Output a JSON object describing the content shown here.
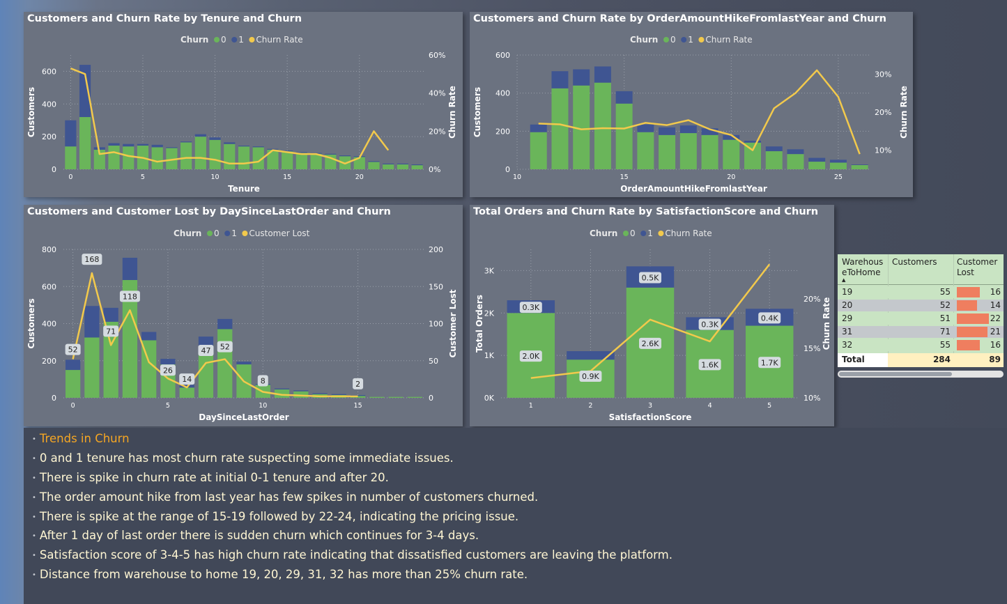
{
  "colors": {
    "churn0": "#6ab55a",
    "churn1": "#3f5592",
    "line": "#f2c94c",
    "grid": "#9aa0aa",
    "text": "#ffffff",
    "table_bar": "#ef7e5f",
    "table_bg": "#c9e4c3",
    "total_bg": "#fff0c0",
    "notes_title": "#f5a623"
  },
  "chart_data": [
    {
      "type": "bar",
      "stacked": true,
      "title": "Customers and Churn Rate by Tenure and Churn",
      "legend": {
        "title": "Churn",
        "items": [
          "0",
          "1",
          "Churn Rate"
        ]
      },
      "xlabel": "Tenure",
      "ylabel": "Customers",
      "y2label": "Churn Rate",
      "xticks": [
        "0",
        "5",
        "10",
        "15",
        "20"
      ],
      "yticks": [
        "0",
        "200",
        "400",
        "600"
      ],
      "y2ticks": [
        "0%",
        "20%",
        "40%",
        "60%"
      ],
      "ylim": [
        0,
        700
      ],
      "y2lim": [
        0,
        0.6
      ],
      "x": [
        0,
        1,
        2,
        3,
        4,
        5,
        6,
        7,
        8,
        9,
        10,
        11,
        12,
        13,
        14,
        15,
        16,
        17,
        18,
        19,
        20,
        21,
        22,
        23,
        24
      ],
      "series": [
        {
          "name": "0",
          "values": [
            140,
            320,
            120,
            145,
            140,
            145,
            135,
            130,
            165,
            200,
            180,
            155,
            140,
            135,
            120,
            110,
            100,
            95,
            90,
            80,
            75,
            45,
            30,
            30,
            25
          ]
        },
        {
          "name": "1",
          "values": [
            160,
            320,
            15,
            15,
            15,
            10,
            15,
            5,
            5,
            15,
            15,
            10,
            5,
            5,
            5,
            5,
            5,
            5,
            5,
            5,
            5,
            5,
            5,
            5,
            5
          ]
        },
        {
          "name": "Churn Rate",
          "values": [
            0.53,
            0.5,
            0.08,
            0.09,
            0.07,
            0.06,
            0.04,
            0.05,
            0.06,
            0.06,
            0.05,
            0.03,
            0.03,
            0.04,
            0.1,
            0.09,
            0.08,
            0.08,
            0.06,
            0.03,
            0.06,
            0.2,
            0.1
          ]
        }
      ]
    },
    {
      "type": "bar",
      "stacked": true,
      "title": "Customers and Churn Rate by OrderAmountHikeFromlastYear and Churn",
      "legend": {
        "title": "Churn",
        "items": [
          "0",
          "1",
          "Churn Rate"
        ]
      },
      "xlabel": "OrderAmountHikeFromlastYear",
      "ylabel": "Customers",
      "y2label": "Churn Rate",
      "xticks": [
        "10",
        "15",
        "20",
        "25"
      ],
      "yticks": [
        "0",
        "200",
        "400",
        "600"
      ],
      "y2ticks": [
        "10%",
        "20%",
        "30%"
      ],
      "ylim": [
        0,
        600
      ],
      "x": [
        11,
        12,
        13,
        14,
        15,
        16,
        17,
        18,
        19,
        20,
        21,
        22,
        23,
        24,
        25,
        26
      ],
      "series": [
        {
          "name": "0",
          "values": [
            195,
            425,
            440,
            455,
            345,
            195,
            180,
            190,
            180,
            155,
            140,
            95,
            80,
            40,
            35,
            22
          ]
        },
        {
          "name": "1",
          "values": [
            40,
            90,
            85,
            85,
            65,
            40,
            40,
            40,
            35,
            25,
            10,
            25,
            25,
            20,
            15,
            3
          ]
        },
        {
          "name": "Churn Rate",
          "values": [
            0.17,
            0.168,
            0.155,
            0.158,
            0.157,
            0.172,
            0.166,
            0.179,
            0.155,
            0.14,
            0.1,
            0.21,
            0.25,
            0.31,
            0.24,
            0.09
          ]
        }
      ]
    },
    {
      "type": "bar",
      "stacked": true,
      "title": "Customers and Customer Lost by DaySinceLastOrder and Churn",
      "legend": {
        "title": "Churn",
        "items": [
          "0",
          "1",
          "Customer Lost"
        ]
      },
      "xlabel": "DaySinceLastOrder",
      "ylabel": "Customers",
      "y2label": "Customer Lost",
      "xticks": [
        "0",
        "5",
        "10",
        "15"
      ],
      "yticks": [
        "0",
        "200",
        "400",
        "600",
        "800"
      ],
      "y2ticks": [
        "0",
        "50",
        "100",
        "150",
        "200"
      ],
      "ylim": [
        0,
        800
      ],
      "y2lim": [
        0,
        200
      ],
      "x": [
        0,
        1,
        2,
        3,
        4,
        5,
        6,
        7,
        8,
        9,
        10,
        11,
        12,
        13,
        14,
        15,
        16,
        17,
        18
      ],
      "series": [
        {
          "name": "0",
          "values": [
            150,
            325,
            410,
            635,
            310,
            180,
            55,
            280,
            370,
            180,
            70,
            45,
            35,
            20,
            15,
            10,
            5,
            5,
            5
          ]
        },
        {
          "name": "1",
          "values": [
            55,
            170,
            75,
            120,
            45,
            30,
            15,
            50,
            55,
            15,
            5,
            5,
            5,
            5,
            5,
            5,
            0,
            0,
            0
          ]
        },
        {
          "name": "Customer Lost",
          "values": [
            52,
            168,
            71,
            118,
            48,
            26,
            14,
            47,
            52,
            22,
            8,
            4,
            3,
            2,
            2,
            2
          ]
        }
      ],
      "data_labels": [
        {
          "x": 0,
          "text": "52"
        },
        {
          "x": 1,
          "text": "168"
        },
        {
          "x": 2,
          "text": "71"
        },
        {
          "x": 3,
          "text": "118"
        },
        {
          "x": 5,
          "text": "26"
        },
        {
          "x": 6,
          "text": "14"
        },
        {
          "x": 7,
          "text": "47"
        },
        {
          "x": 8,
          "text": "52"
        },
        {
          "x": 10,
          "text": "8"
        },
        {
          "x": 15,
          "text": "2"
        }
      ]
    },
    {
      "type": "bar",
      "stacked": true,
      "title": "Total Orders and Churn Rate by SatisfactionScore and Churn",
      "legend": {
        "title": "Churn",
        "items": [
          "0",
          "1",
          "Churn Rate"
        ]
      },
      "xlabel": "SatisfactionScore",
      "ylabel": "Total Orders",
      "y2label": "Churn Rate",
      "xticks": [
        "1",
        "2",
        "3",
        "4",
        "5"
      ],
      "yticks": [
        "0K",
        "1K",
        "2K",
        "3K"
      ],
      "y2ticks": [
        "10%",
        "15%",
        "20%"
      ],
      "ylim": [
        0,
        3500
      ],
      "y2lim": [
        0.1,
        0.25
      ],
      "x": [
        1,
        2,
        3,
        4,
        5
      ],
      "series": [
        {
          "name": "0",
          "values": [
            2000,
            900,
            2600,
            1600,
            1700
          ],
          "labels": [
            "2.0K",
            "0.9K",
            "2.6K",
            "1.6K",
            "1.7K"
          ]
        },
        {
          "name": "1",
          "values": [
            300,
            200,
            500,
            300,
            400
          ],
          "labels": [
            "0.3K",
            "",
            "0.5K",
            "0.3K",
            "0.4K"
          ]
        },
        {
          "name": "Churn Rate",
          "values": [
            0.12,
            0.127,
            0.179,
            0.157,
            0.235
          ]
        }
      ]
    }
  ],
  "table": {
    "headers": [
      "Warehous eToHome",
      "Customers",
      "Customer Lost"
    ],
    "header_line1": "Warehous",
    "header_line2": "eToHome",
    "header_col2": "Customers",
    "header_col3_line1": "Customer",
    "header_col3_line2": "Lost",
    "sort_indicator": "▲",
    "rows": [
      {
        "warehouse": "19",
        "customers": "55",
        "lost": "16"
      },
      {
        "warehouse": "20",
        "customers": "52",
        "lost": "14"
      },
      {
        "warehouse": "29",
        "customers": "51",
        "lost": "22"
      },
      {
        "warehouse": "31",
        "customers": "71",
        "lost": "21"
      },
      {
        "warehouse": "32",
        "customers": "55",
        "lost": "16"
      }
    ],
    "lost_values": [
      16,
      14,
      22,
      21,
      16
    ],
    "lost_max": 22,
    "total": {
      "label": "Total",
      "customers": "284",
      "lost": "89"
    }
  },
  "notes": {
    "title": "Trends in Churn",
    "lines": [
      "0 and 1 tenure has most churn rate suspecting some immediate issues.",
      "There is spike in churn rate at initial 0-1 tenure and after 20.",
      "The order amount hike from last year has few spikes in number of customers churned.",
      "There is spike at the range of 15-19 followed by 22-24, indicating the pricing issue.",
      "After 1 day of last order there is sudden churn which continues for 3-4 days.",
      "Satisfaction score of 3-4-5 has high churn rate indicating that dissatisfied customers are leaving the platform.",
      "Distance from warehouse to home 19, 20, 29, 31, 32 has more than 25% churn rate."
    ],
    "bullet": "•"
  }
}
